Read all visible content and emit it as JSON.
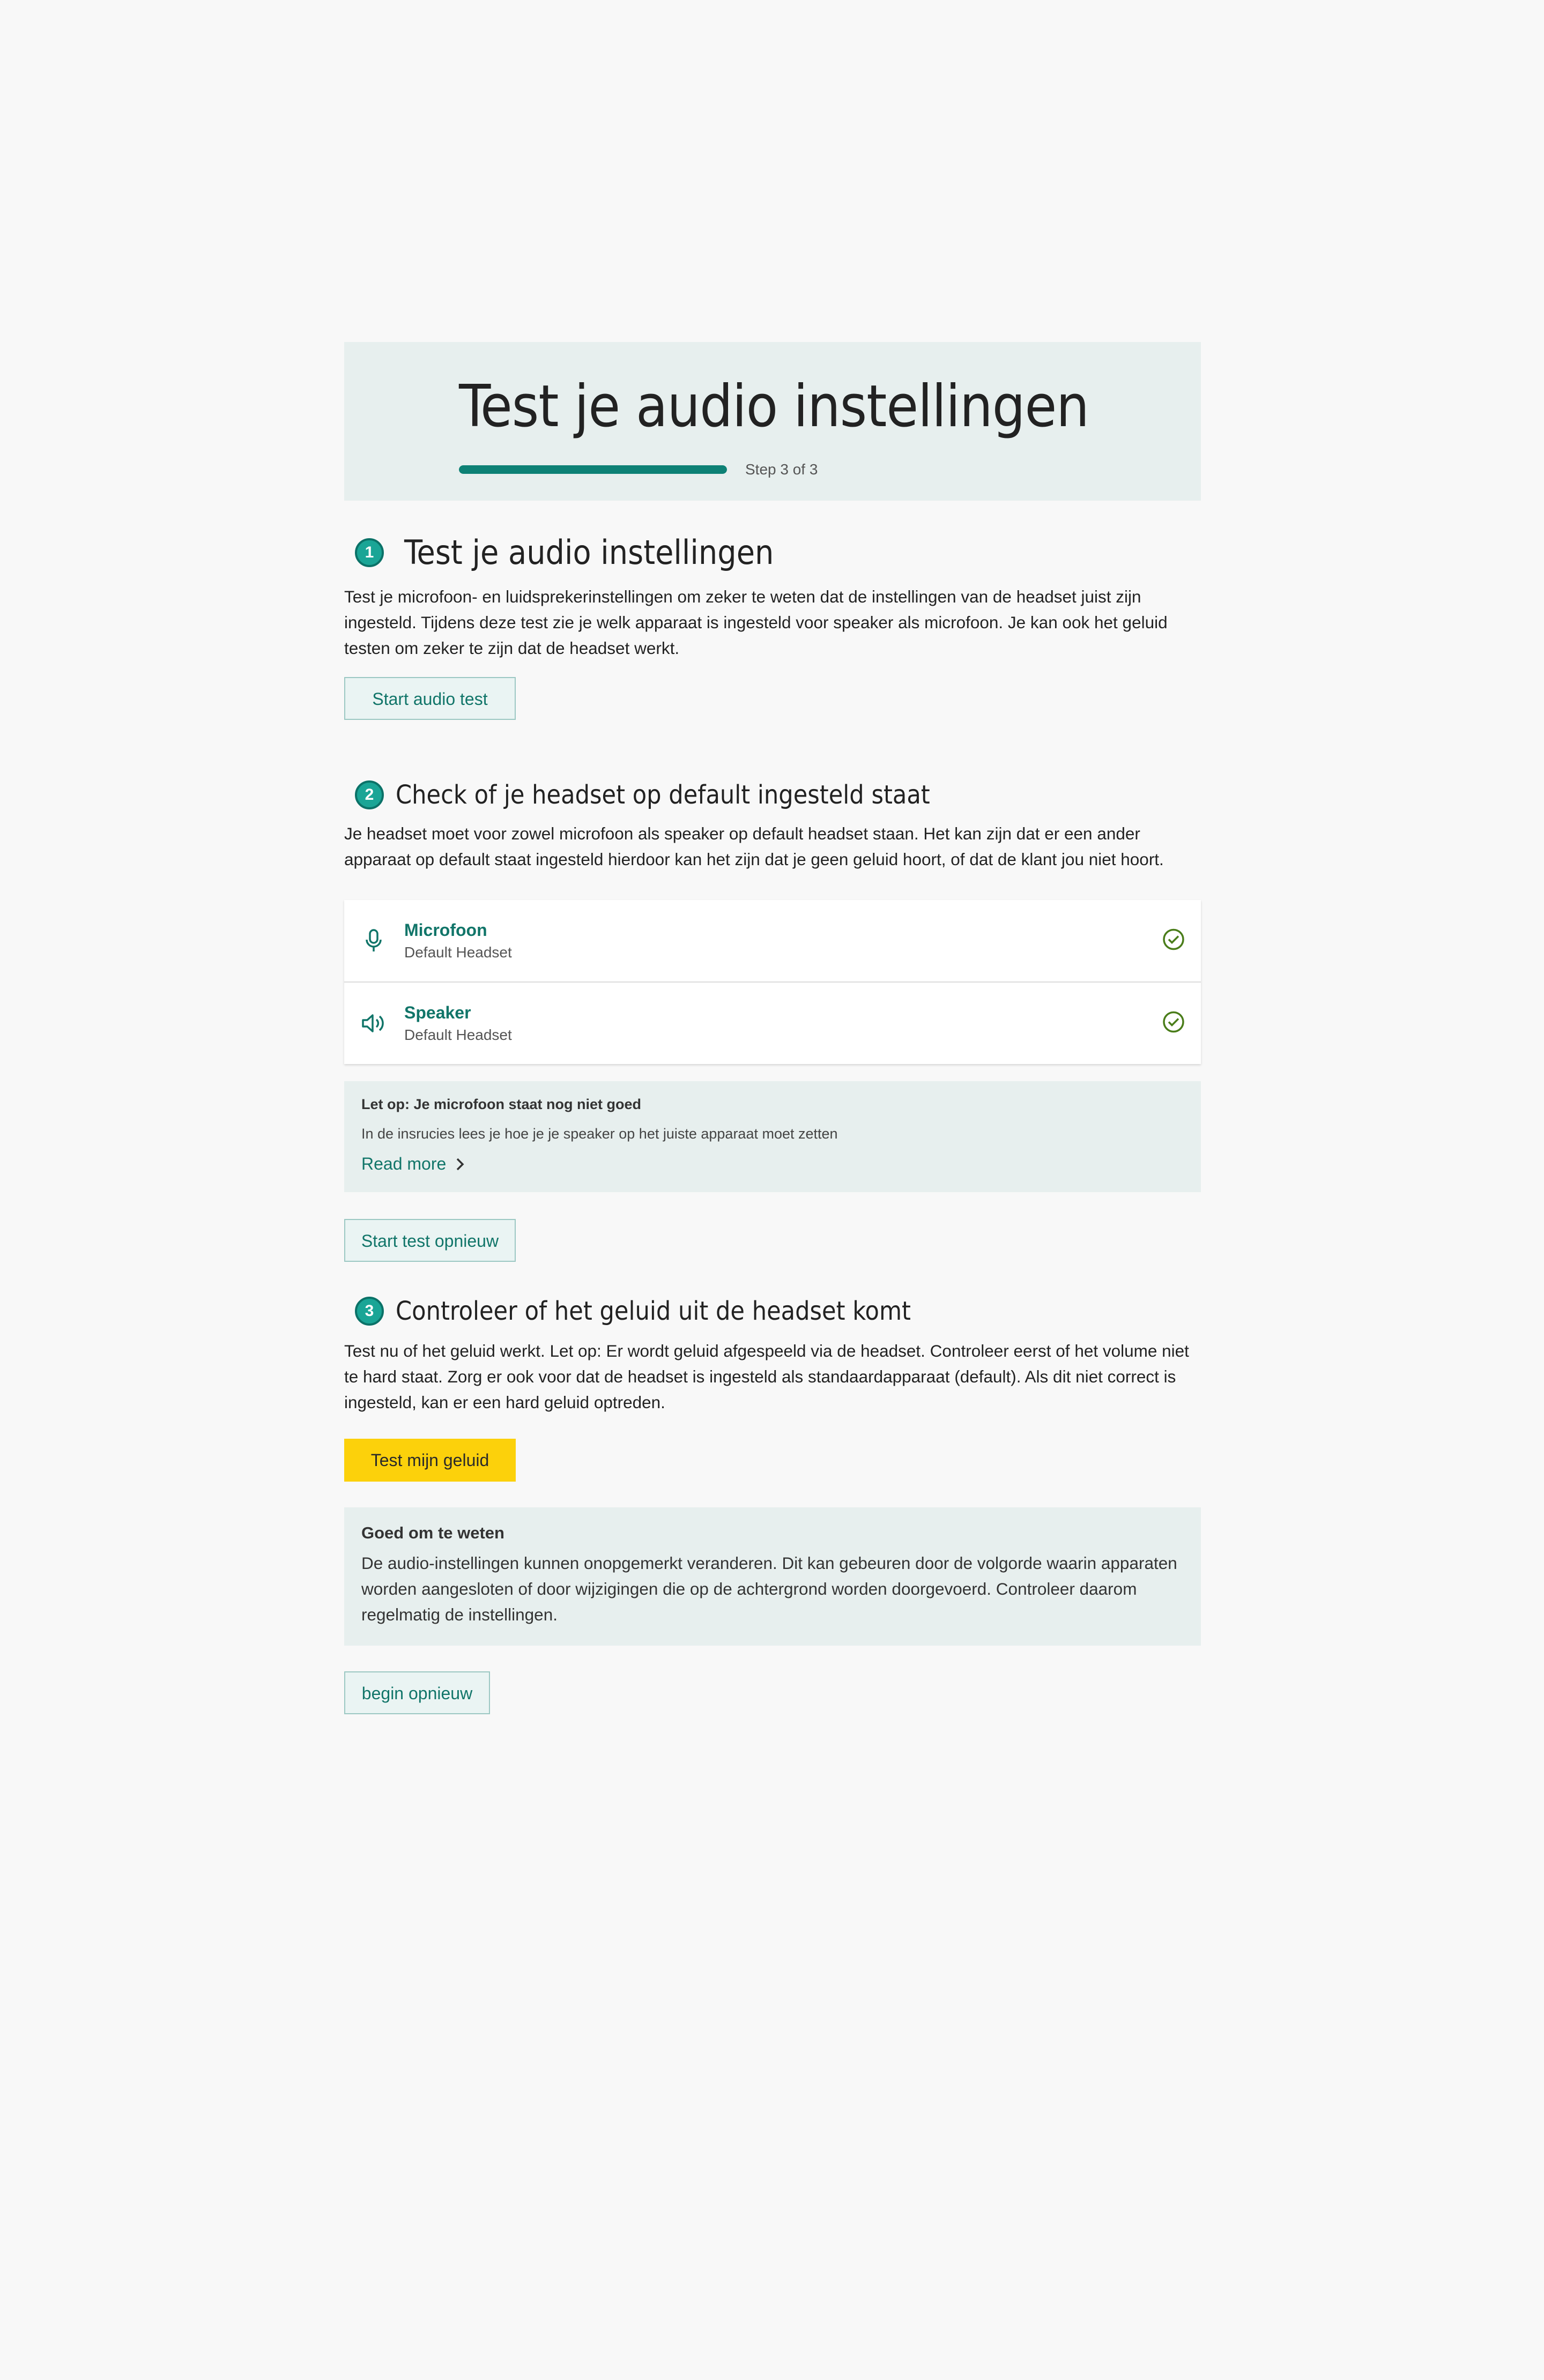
{
  "header": {
    "title": "Test je audio instellingen",
    "progress_fraction": 1.0,
    "step_label": "Step 3 of 3"
  },
  "step1": {
    "number": "1",
    "title": "Test je audio instellingen",
    "text": "Test je microfoon- en luidsprekerinstellingen om zeker te weten dat de instellingen van de headset juist zijn ingesteld. Tijdens deze test zie je welk apparaat is ingesteld voor speaker als microfoon. Je kan ook het geluid testen om zeker te zijn dat de headset werkt.",
    "button": "Start audio test"
  },
  "step2": {
    "number": "2",
    "title": "Check of je headset op default ingesteld staat",
    "text": "Je headset moet voor zowel microfoon als speaker op default headset staan. Het kan zijn dat er een ander apparaat op default staat ingesteld hierdoor kan het zijn dat je geen geluid hoort, of dat de klant jou niet hoort.",
    "devices": [
      {
        "name": "Microfoon",
        "value": "Default Headset",
        "icon": "microphone-icon",
        "status": "check-circle-icon"
      },
      {
        "name": "Speaker",
        "value": "Default Headset",
        "icon": "speaker-icon",
        "status": "check-circle-icon"
      }
    ],
    "notice": {
      "title": "Let op: Je microfoon staat nog niet goed",
      "text": "In de insrucies lees je hoe je je speaker op het juiste apparaat moet zetten",
      "link": "Read more"
    },
    "button": "Start test opnieuw"
  },
  "step3": {
    "number": "3",
    "title": "Controleer of het geluid uit de headset komt",
    "text": "Test nu of het geluid werkt. Let op: Er wordt geluid afgespeeld via de headset. Controleer eerst of het volume niet te hard staat. Zorg er ook voor dat de headset is ingesteld als standaardapparaat (default). Als dit niet correct is ingesteld, kan er een hard geluid optreden.",
    "button": "Test mijn geluid"
  },
  "info": {
    "title": "Goed om te weten",
    "text": "De audio-instellingen kunnen onopgemerkt veranderen. Dit kan gebeuren door de volgorde waarin apparaten worden aangesloten of door wijzigingen die op de achtergrond worden doorgevoerd. Controleer daarom regelmatig de instellingen."
  },
  "restart_button": "begin opnieuw",
  "colors": {
    "accent": "#117569",
    "progress": "#0d8175",
    "primary_button": "#fcd10b",
    "panel": "#e7efee",
    "check": "#4a7d1a"
  }
}
